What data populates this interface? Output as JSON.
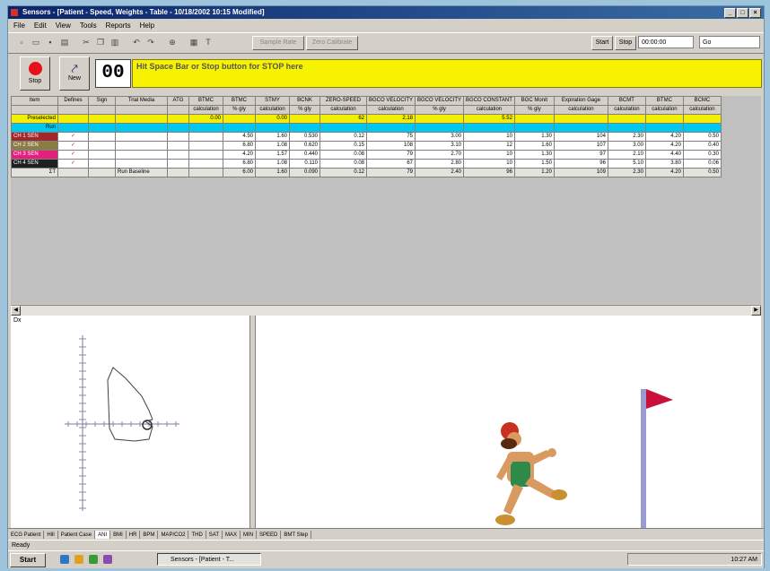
{
  "titlebar": {
    "title": "Sensors - [Patient - Speed, Weights - Table - 10/18/2002 10:15 Modified]",
    "buttons": [
      "_",
      "□",
      "×"
    ]
  },
  "menu": [
    "File",
    "Edit",
    "View",
    "Tools",
    "Reports",
    "Help"
  ],
  "toolbar": {
    "btn_a": "Sample Rate",
    "btn_b": "Zero Calibrate",
    "label_start": "Start",
    "label_stop": "Stop",
    "time_value": "00:00:00",
    "search_value": "Go"
  },
  "controls": {
    "stop_label": "Stop",
    "new_label": "New",
    "counter": "00",
    "banner": "Hit Space Bar or Stop button for STOP here"
  },
  "grid": {
    "header1": [
      "Item",
      "Defines",
      "Sign",
      "Trial Media",
      "ATG",
      "BTMC",
      "BTMC",
      "STMY",
      "BCNK",
      "ZERO-SPEED",
      "BGCO VELOCITY",
      "BGCO VELOCITY",
      "BGCO CONSTANT",
      "BGC Monit",
      "Expiration Gage",
      "BCMT",
      "BTMC",
      "BCMC"
    ],
    "header2": [
      "",
      "",
      "",
      "",
      "",
      "calculation",
      "% gly",
      "calculation",
      "% gly",
      "calculation",
      "calculation",
      "% gly",
      "calculation",
      "% gly",
      "calculation",
      "calculation",
      "calculation",
      "calculation"
    ],
    "yellow_row": [
      "Preselected",
      "",
      "",
      "",
      "",
      "0.00",
      "",
      "0.00",
      "",
      "62",
      "2.18",
      "",
      "5.52",
      "",
      "",
      "",
      "",
      ""
    ],
    "cyan_row_label": "Run",
    "rows": [
      {
        "label": "CH 1 SEN",
        "color": "#a0282a",
        "check": "✓",
        "cells": [
          "",
          "",
          "4.50",
          "1.60",
          "0.530",
          "0.12",
          "75",
          "3.00",
          "10",
          "1.30",
          "104",
          "2.30",
          "4.20",
          "0.50"
        ]
      },
      {
        "label": "CH 2 SEN",
        "color": "#8a7d42",
        "check": "✓",
        "cells": [
          "",
          "",
          "6.80",
          "1.08",
          "0.620",
          "0.15",
          "108",
          "3.10",
          "12",
          "1.60",
          "107",
          "3.00",
          "4.20",
          "0.40"
        ]
      },
      {
        "label": "CH 3 SEN",
        "color": "#e4207e",
        "check": "✓",
        "cells": [
          "",
          "",
          "4.20",
          "1.57",
          "0.440",
          "0.08",
          "79",
          "2.70",
          "10",
          "1.30",
          "97",
          "2.10",
          "4.40",
          "0.30"
        ]
      },
      {
        "label": "CH 4 SEN",
        "color": "#202020",
        "check": "✓",
        "cells": [
          "",
          "",
          "6.80",
          "1.08",
          "0.110",
          "0.08",
          "67",
          "2.80",
          "10",
          "1.50",
          "96",
          "5.10",
          "3.80",
          "0.06"
        ]
      }
    ],
    "total_row": {
      "label": "ΣT",
      "media": "Run Baseline",
      "cells": [
        "6.00",
        "1.60",
        "0.090",
        "0.12",
        "79",
        "2.40",
        "96",
        "1.20",
        "109",
        "2.30",
        "4.20",
        "0.50"
      ]
    }
  },
  "lower": {
    "pane_label": "Dx"
  },
  "tabs": [
    "ECG Patient",
    "Hill",
    "Patient Case",
    "ANI",
    "BMI",
    "HR",
    "BPM",
    "MAP/CO2",
    "THD",
    "SAT",
    "MAX",
    "MIN",
    "SPEED",
    "BMT Step"
  ],
  "active_tab_index": 3,
  "status": "Ready",
  "taskbar": {
    "start": "Start",
    "task": "Sensors - [Patient - T...",
    "clock": "10:27 AM"
  },
  "colors": {
    "banner": "#f7f200",
    "yellow_row": "#f4ee00",
    "cyan_row": "#00c8f0",
    "flag": "#c8103a",
    "pole": "#9a9ad0",
    "title_blue": "#0a246a"
  },
  "icons": {
    "stop": "stop-record-icon",
    "new": "new-trial-icon",
    "flag": "finish-flag-icon",
    "runner": "running-man-icon"
  }
}
